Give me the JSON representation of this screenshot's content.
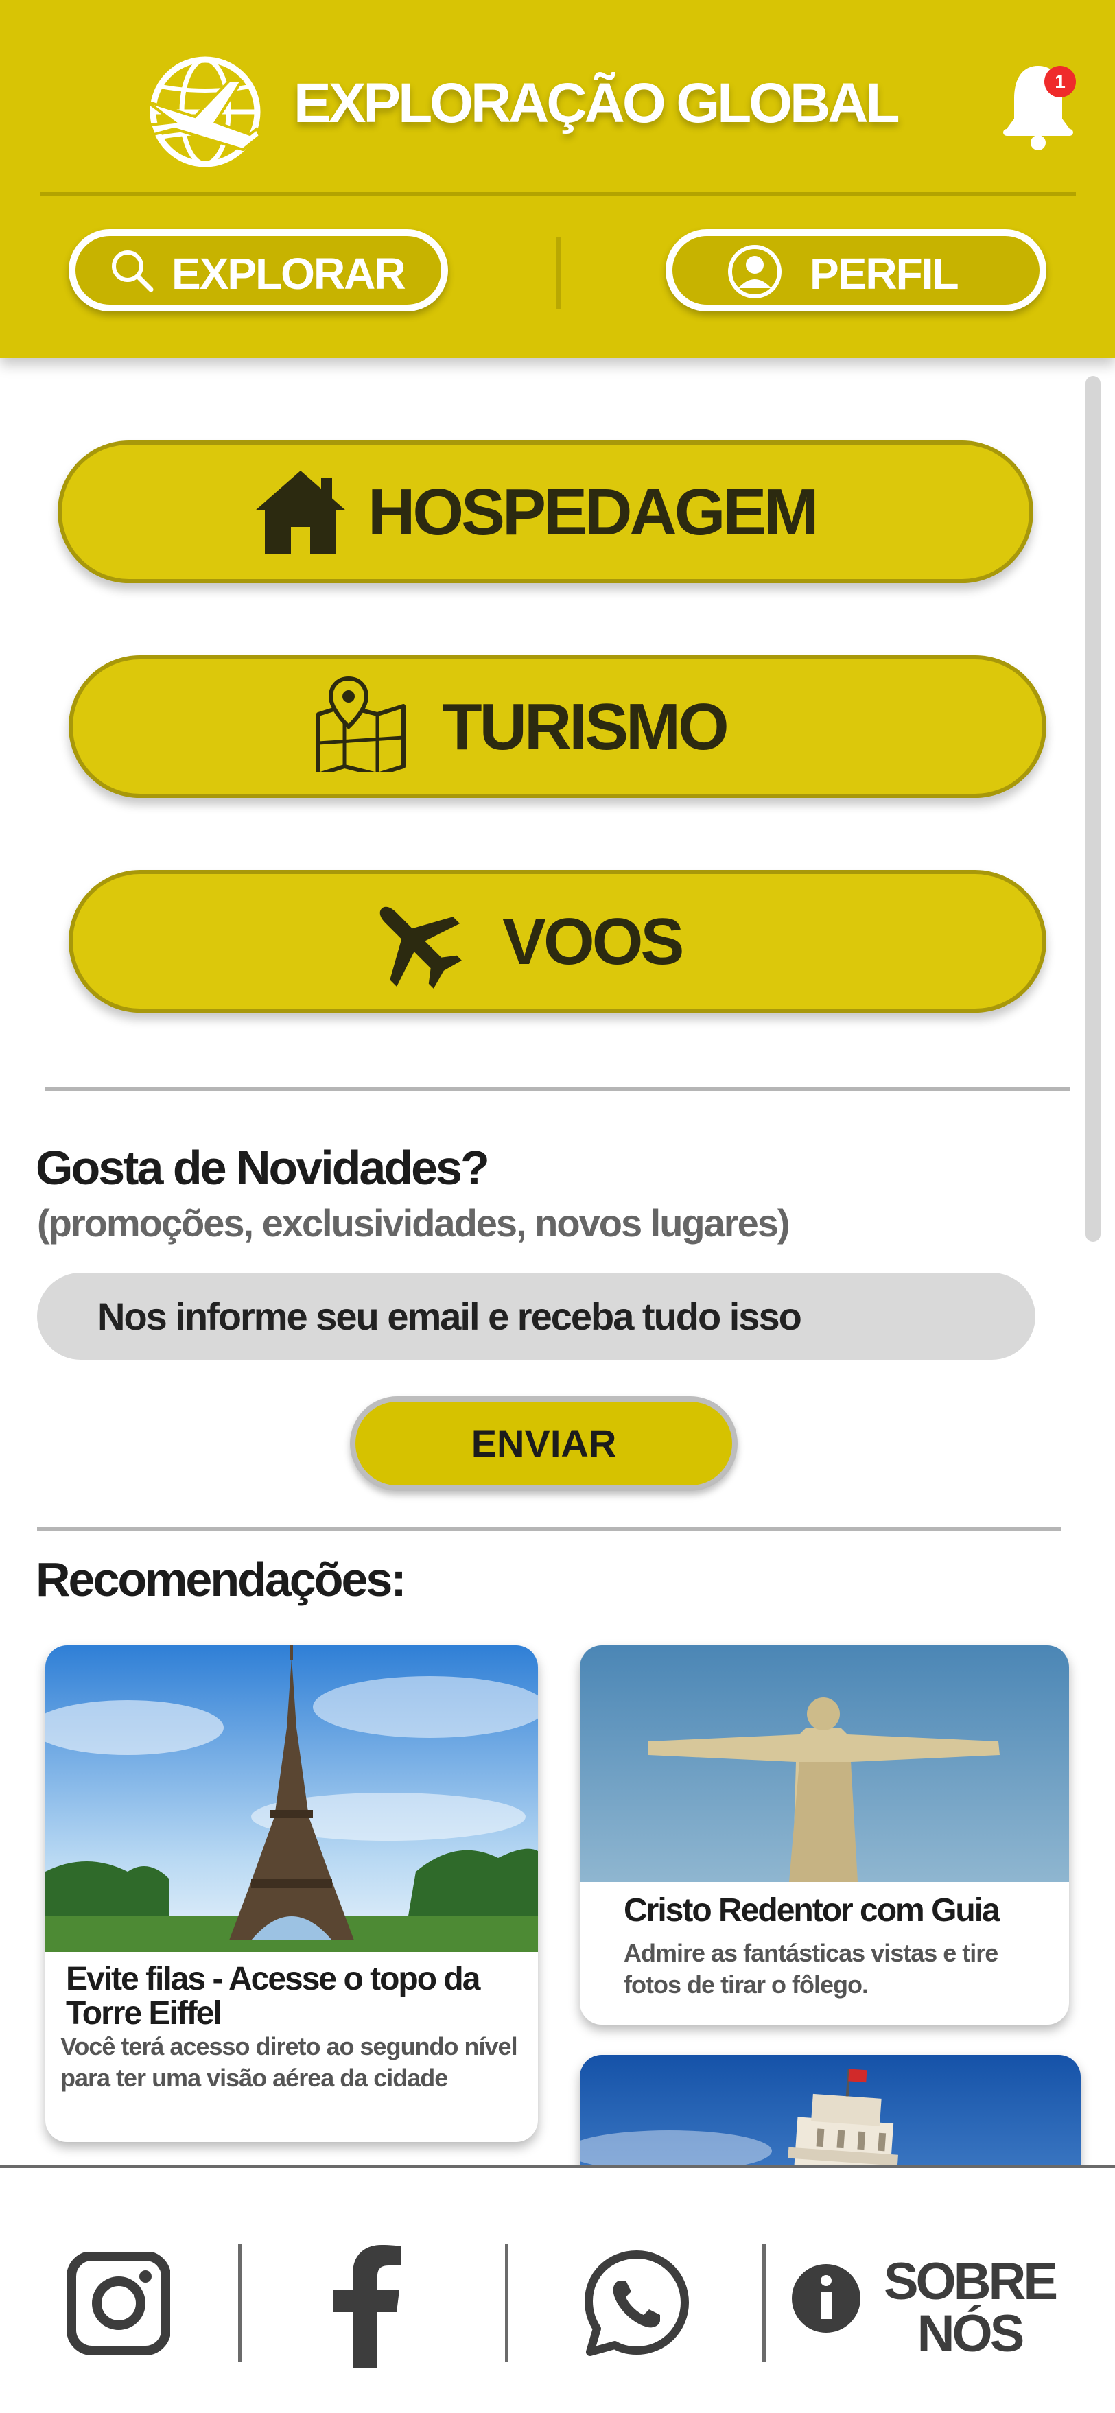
{
  "header": {
    "title": "EXPLORAÇÃO GLOBAL",
    "notification_count": "1",
    "explore_label": "EXPLORAR",
    "profile_label": "PERFIL"
  },
  "categories": [
    {
      "label": "HOSPEDAGEM",
      "icon": "house-icon"
    },
    {
      "label": "TURISMO",
      "icon": "map-pin-icon"
    },
    {
      "label": "VOOS",
      "icon": "airplane-icon"
    }
  ],
  "newsletter": {
    "title": "Gosta de Novidades?",
    "subtitle": "(promoções, exclusividades, novos lugares)",
    "email_placeholder": "Nos informe seu email e receba tudo isso",
    "send_label": "ENVIAR"
  },
  "recommendations": {
    "title": "Recomendações:",
    "cards": [
      {
        "title": "Evite filas - Acesse o topo da Torre Eiffel",
        "description": "Você terá acesso direto ao segundo nível para ter uma visão aérea da cidade",
        "image": "eiffel-tower-photo"
      },
      {
        "title": "Cristo Redentor com Guia",
        "description": "Admire as fantásticas vistas e tire fotos de tirar o fôlego.",
        "image": "christ-redeemer-photo"
      },
      {
        "title": "",
        "description": "",
        "image": "leaning-tower-pisa-photo"
      }
    ]
  },
  "footer": {
    "items": [
      "instagram-icon",
      "facebook-icon",
      "whatsapp-icon",
      "info-icon"
    ],
    "about_label_line1": "SOBRE",
    "about_label_line2": "NÓS"
  },
  "colors": {
    "brand_yellow": "#d8c405",
    "button_yellow": "#dcc80b",
    "badge_red": "#ef2b2b"
  }
}
